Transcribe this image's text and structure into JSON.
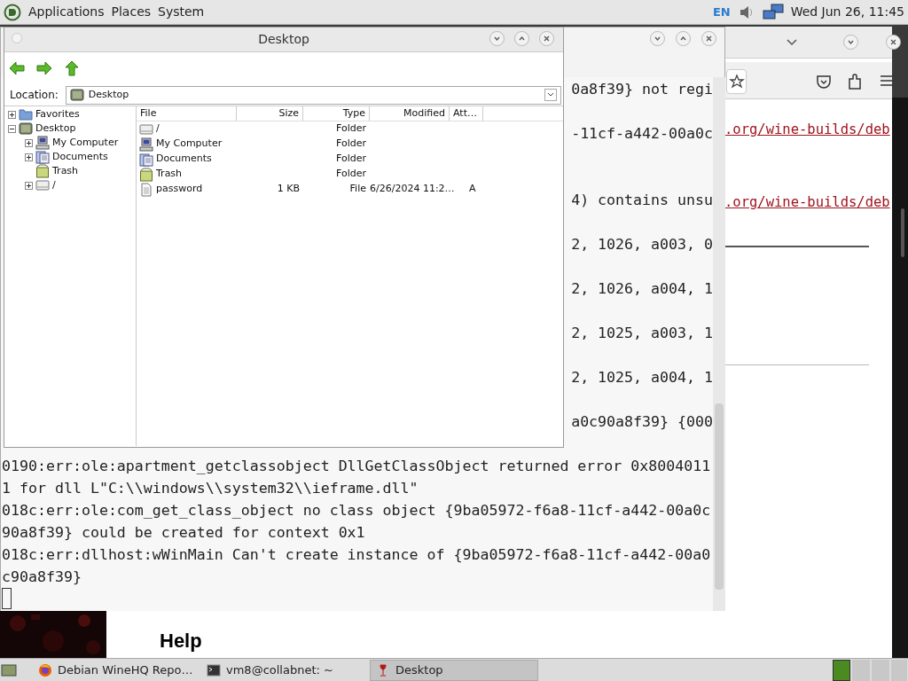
{
  "top_panel": {
    "menus": [
      "Applications",
      "Places",
      "System"
    ],
    "keyboard_layout": "EN",
    "clock": "Wed Jun 26, 11:45"
  },
  "browser": {
    "links": [
      ".org/wine-builds/deb",
      ".org/wine-builds/deb"
    ],
    "heading": "Help"
  },
  "terminal": {
    "lines": [
      {
        "kind": "clipped",
        "text": "0a8f39} not regi"
      },
      {
        "kind": "blank"
      },
      {
        "kind": "clipped",
        "text": "-11cf-a442-00a0c"
      },
      {
        "kind": "blank"
      },
      {
        "kind": "blank"
      },
      {
        "kind": "clipped",
        "text": "4) contains unsu"
      },
      {
        "kind": "blank"
      },
      {
        "kind": "clipped",
        "text": "2, 1026, a003, 0"
      },
      {
        "kind": "blank"
      },
      {
        "kind": "clipped",
        "text": "2, 1026, a004, 1"
      },
      {
        "kind": "blank"
      },
      {
        "kind": "clipped",
        "text": "2, 1025, a003, 1"
      },
      {
        "kind": "blank"
      },
      {
        "kind": "clipped",
        "text": "2, 1025, a004, 1"
      },
      {
        "kind": "blank"
      },
      {
        "kind": "clipped",
        "text": "a0c90a8f39} {000"
      },
      {
        "kind": "blank"
      },
      {
        "kind": "full",
        "text": "0190:err:ole:apartment_getclassobject DllGetClassObject returned error 0x8004011"
      },
      {
        "kind": "full",
        "text": "1 for dll L\"C:\\\\windows\\\\system32\\\\ieframe.dll\""
      },
      {
        "kind": "full",
        "text": "018c:err:ole:com_get_class_object no class object {9ba05972-f6a8-11cf-a442-00a0c"
      },
      {
        "kind": "full",
        "text": "90a8f39} could be created for context 0x1"
      },
      {
        "kind": "full",
        "text": "018c:err:dllhost:wWinMain Can't create instance of {9ba05972-f6a8-11cf-a442-00a0"
      },
      {
        "kind": "full",
        "text": "c90a8f39}"
      }
    ]
  },
  "file_manager": {
    "title": "Desktop",
    "location_label": "Location:",
    "location": "Desktop",
    "tree": [
      {
        "kind": "favorites",
        "label": "Favorites",
        "expanded": false
      },
      {
        "kind": "desktop",
        "label": "Desktop",
        "expanded": true,
        "children": [
          {
            "kind": "computer",
            "label": "My Computer",
            "expanded": false
          },
          {
            "kind": "documents",
            "label": "Documents",
            "expanded": false
          },
          {
            "kind": "trash",
            "label": "Trash"
          },
          {
            "kind": "drive",
            "label": "/",
            "expanded": false
          }
        ]
      }
    ],
    "columns": [
      "File",
      "Size",
      "Type",
      "Modified",
      "Att…"
    ],
    "rows": [
      {
        "kind": "drive",
        "name": "/",
        "type": "Folder"
      },
      {
        "kind": "computer",
        "name": "My Computer",
        "type": "Folder"
      },
      {
        "kind": "documents",
        "name": "Documents",
        "type": "Folder"
      },
      {
        "kind": "trash",
        "name": "Trash",
        "type": "Folder"
      },
      {
        "kind": "file",
        "name": "password",
        "size": "1 KB",
        "type": "File",
        "modified": "6/26/2024 11:2…",
        "attributes": "A"
      }
    ]
  },
  "taskbar": {
    "tasks": [
      {
        "kind": "browser",
        "label": "Debian WineHQ Repo…",
        "selected": false
      },
      {
        "kind": "terminal",
        "label": "vm8@collabnet: ~",
        "selected": false
      },
      {
        "kind": "wine",
        "label": "Desktop",
        "selected": true
      }
    ]
  }
}
